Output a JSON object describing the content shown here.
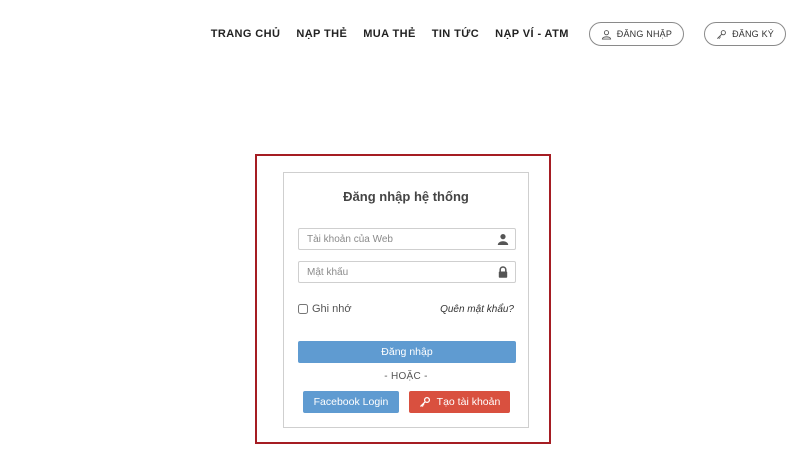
{
  "nav": {
    "links": [
      "TRANG CHỦ",
      "NẠP THẺ",
      "MUA THẺ",
      "TIN TỨC",
      "NẠP VÍ - ATM"
    ],
    "login_label": "ĐĂNG NHẬP",
    "register_label": "ĐĂNG KÝ"
  },
  "login": {
    "title": "Đăng nhập hệ thống",
    "username_placeholder": "Tài khoản của Web",
    "password_placeholder": "Mật khẩu",
    "remember_label": "Ghi nhớ",
    "forgot_label": "Quên mật khẩu?",
    "submit_label": "Đăng nhập",
    "or_label": "- HOẶC -",
    "facebook_label": "Facebook Login",
    "create_label": "Tạo tài khoản"
  },
  "colors": {
    "primary": "#5f9bd1",
    "danger": "#d9503f",
    "frame": "#a51d23"
  },
  "icons": {
    "nav_login": "user-icon",
    "nav_register": "key-icon",
    "username": "user-icon",
    "password": "lock-icon",
    "create": "key-icon"
  }
}
